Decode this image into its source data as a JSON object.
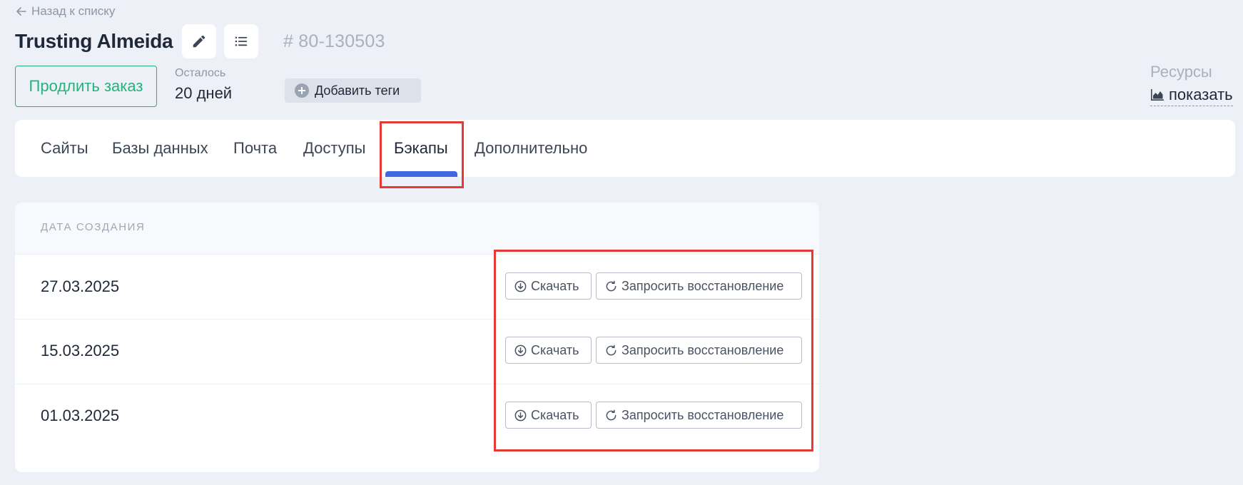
{
  "header": {
    "back_label": "Назад к списку",
    "title": "Trusting Almeida",
    "order_number": "# 80-130503"
  },
  "order": {
    "extend_label": "Продлить заказ",
    "remaining_label": "Осталось",
    "remaining_value": "20 дней",
    "add_tags_label": "Добавить теги"
  },
  "resources": {
    "label": "Ресурсы",
    "show_label": "показать"
  },
  "tabs": [
    {
      "label": "Сайты"
    },
    {
      "label": "Базы данных"
    },
    {
      "label": "Почта"
    },
    {
      "label": "Доступы"
    },
    {
      "label": "Бэкапы",
      "active": true
    },
    {
      "label": "Дополнительно"
    }
  ],
  "backups": {
    "column_header": "ДАТА СОЗДАНИЯ",
    "rows": [
      {
        "date": "27.03.2025",
        "download_label": "Скачать",
        "restore_label": "Запросить восстановление"
      },
      {
        "date": "15.03.2025",
        "download_label": "Скачать",
        "restore_label": "Запросить восстановление"
      },
      {
        "date": "01.03.2025",
        "download_label": "Скачать",
        "restore_label": "Запросить восстановление"
      }
    ]
  },
  "colors": {
    "accent_green": "#26b27a",
    "tab_active_underline": "#4167e0",
    "highlight_red": "#e53935",
    "page_background": "#edf1f7"
  },
  "icons": {
    "back": "arrow-left-icon",
    "edit": "pencil-icon",
    "list": "list-icon",
    "add_tags": "plus-circle-icon",
    "resources": "area-chart-icon",
    "download": "download-circle-icon",
    "restore": "refresh-icon"
  }
}
